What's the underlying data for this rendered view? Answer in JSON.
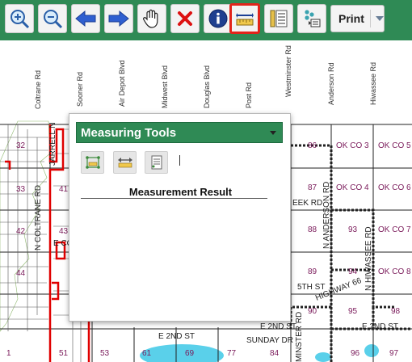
{
  "toolbar": {
    "buttons": [
      {
        "name": "zoom-in",
        "icon": "zoom-in-icon"
      },
      {
        "name": "zoom-out",
        "icon": "zoom-out-icon"
      },
      {
        "name": "back",
        "icon": "arrow-left-icon"
      },
      {
        "name": "forward",
        "icon": "arrow-right-icon"
      },
      {
        "name": "pan",
        "icon": "hand-icon"
      },
      {
        "name": "clear",
        "icon": "close-icon"
      },
      {
        "name": "identify",
        "icon": "info-icon"
      },
      {
        "name": "measure",
        "icon": "ruler-icon",
        "active": true
      },
      {
        "name": "legend",
        "icon": "legend-icon"
      },
      {
        "name": "layers",
        "icon": "layers-icon"
      }
    ],
    "print_label": "Print"
  },
  "map": {
    "road_labels": [
      "Coltrane Rd",
      "Sooner Rd",
      "Air Depot Blvd",
      "Midwest Blvd",
      "Douglas Blvd",
      "Post Rd",
      "Westminster Rd",
      "Anderson Rd",
      "Hiwassee Rd"
    ],
    "street_labels": [
      "N ANDERSON RD",
      "N HIWASSEE RD",
      "HIGHWAY 66",
      "5TH ST",
      "E 2ND ST",
      "E 2ND ST",
      "E 2ND ST",
      "SUNDAY DR",
      "MINSTER RD",
      "EEK RD",
      "E COVE",
      "N COLTRANE RD",
      "JARRELL N"
    ],
    "cells": [
      "86",
      "87",
      "88",
      "89",
      "90",
      "93",
      "94",
      "95",
      "96",
      "97",
      "98",
      "OK CO 3",
      "OK CO 5",
      "OK CO 4",
      "OK CO 6",
      "OK CO 7",
      "OK CO 8",
      "32",
      "33",
      "41",
      "42",
      "43",
      "44",
      "53",
      "61",
      "69",
      "77",
      "84",
      "1",
      "51"
    ]
  },
  "measuring_panel": {
    "title": "Measuring Tools",
    "tools": [
      {
        "name": "measure-area",
        "icon": "area-measure-icon"
      },
      {
        "name": "measure-distance",
        "icon": "distance-measure-icon"
      },
      {
        "name": "measure-location",
        "icon": "location-measure-icon"
      }
    ],
    "result_title": "Measurement Result"
  },
  "colors": {
    "toolbar_bg": "#2f8a55",
    "panel_header_bg": "#2f8a55",
    "active_border": "#e2231a",
    "cell_text": "#7a1a5a",
    "boundary": "#e00000"
  }
}
